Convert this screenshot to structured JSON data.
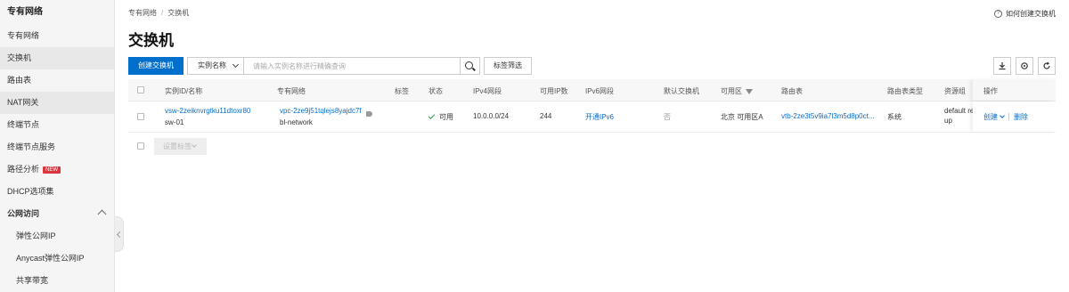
{
  "sidebar": {
    "title": "专有网络",
    "items": [
      {
        "label": "专有网络"
      },
      {
        "label": "交换机"
      },
      {
        "label": "路由表"
      },
      {
        "label": "NAT网关"
      },
      {
        "label": "终端节点"
      },
      {
        "label": "终端节点服务"
      },
      {
        "label": "路径分析",
        "badge": "NEW"
      },
      {
        "label": "DHCP选项集"
      },
      {
        "label": "公网访问"
      },
      {
        "label": "弹性公网IP"
      },
      {
        "label": "Anycast弹性公网IP"
      },
      {
        "label": "共享带宽"
      }
    ]
  },
  "breadcrumb": {
    "root": "专有网络",
    "sep": "/",
    "current": "交换机"
  },
  "help": {
    "icon": "?",
    "label": "如何创建交换机"
  },
  "page_title": "交换机",
  "toolbar": {
    "create_label": "创建交换机",
    "field_select": "实例名称",
    "search_placeholder": "请输入实例名称进行精确查询",
    "tag_filter_label": "标签筛选"
  },
  "tool_icons": {
    "download": "download-icon",
    "settings": "gear-icon",
    "refresh": "refresh-icon"
  },
  "table": {
    "headers": {
      "id_name": "实例ID/名称",
      "vpc": "专有网络",
      "tag": "标签",
      "status": "状态",
      "ipv4": "IPv4网段",
      "ip_count": "可用IP数",
      "ipv6": "IPv6网段",
      "default_switch": "默认交换机",
      "zone": "可用区",
      "route_table": "路由表",
      "route_table_type": "路由表类型",
      "resource_group": "资源组",
      "actions": "操作"
    },
    "rows": [
      {
        "id": "vsw-2zeiknvrgtku11dtoxr80",
        "name": "sw-01",
        "vpc_id": "vpc-2ze9j51tqlejs8yajdc7f",
        "vpc_name": "bl-network",
        "status": "可用",
        "ipv4": "10.0.0.0/24",
        "ip_count": "244",
        "ipv6": "开通IPv6",
        "default_switch": "否",
        "zone": "北京 可用区A",
        "route_table": "vtb-2ze3t5v9ia7l3m5d8p0ct...",
        "route_table_type": "系统",
        "resource_group_line1": "default re",
        "resource_group_line2": "up",
        "action_create": "创建",
        "action_delete": "删除"
      }
    ],
    "batch_label": "设置标签"
  },
  "colors": {
    "primary": "#0070cc",
    "link": "#0a6ec9",
    "success": "#2aa34a",
    "badge": "#d9363e"
  }
}
